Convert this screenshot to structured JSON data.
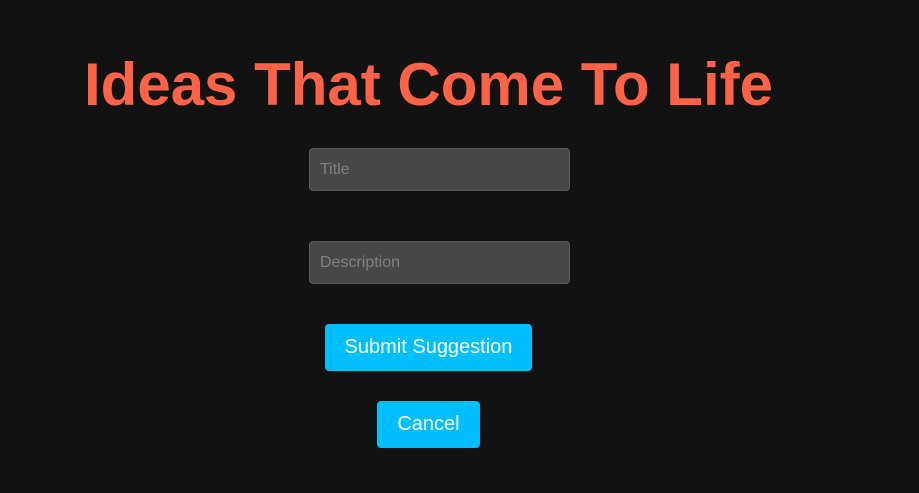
{
  "header": {
    "title": "Ideas That Come To Life"
  },
  "form": {
    "title_field": {
      "value": "",
      "placeholder": "Title"
    },
    "description_field": {
      "value": "",
      "placeholder": "Description"
    },
    "submit_label": "Submit Suggestion",
    "cancel_label": "Cancel"
  },
  "colors": {
    "background": "#121212",
    "title": "#ff6347",
    "input_background": "#474747",
    "button": "#00bfff",
    "button_text": "#ffffff"
  }
}
